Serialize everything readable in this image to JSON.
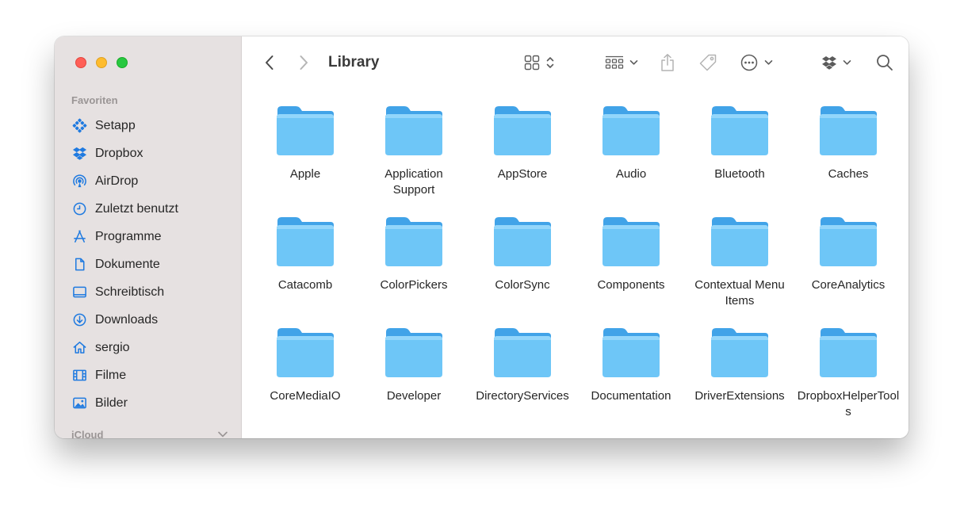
{
  "toolbar": {
    "title": "Library"
  },
  "sidebar": {
    "favorites_label": "Favoriten",
    "icloud_label": "iCloud",
    "items": [
      {
        "label": "Setapp",
        "icon": "setapp-icon"
      },
      {
        "label": "Dropbox",
        "icon": "dropbox-icon"
      },
      {
        "label": "AirDrop",
        "icon": "airdrop-icon"
      },
      {
        "label": "Zuletzt benutzt",
        "icon": "clock-icon"
      },
      {
        "label": "Programme",
        "icon": "apps-icon"
      },
      {
        "label": "Dokumente",
        "icon": "document-icon"
      },
      {
        "label": "Schreibtisch",
        "icon": "desktop-icon"
      },
      {
        "label": "Downloads",
        "icon": "download-icon"
      },
      {
        "label": "sergio",
        "icon": "home-icon"
      },
      {
        "label": "Filme",
        "icon": "film-icon"
      },
      {
        "label": "Bilder",
        "icon": "photo-icon"
      }
    ]
  },
  "folders": [
    "Apple",
    "Application Support",
    "AppStore",
    "Audio",
    "Bluetooth",
    "Caches",
    "Catacomb",
    "ColorPickers",
    "ColorSync",
    "Components",
    "Contextual Menu Items",
    "CoreAnalytics",
    "CoreMediaIO",
    "Developer",
    "DirectoryServices",
    "Documentation",
    "DriverExtensions",
    "DropboxHelperTools"
  ],
  "colors": {
    "accent": "#1f7ae0",
    "folder_front": "#6ec6f7",
    "folder_back": "#41a3e8",
    "sidebar_bg": "#e6e1e1"
  }
}
